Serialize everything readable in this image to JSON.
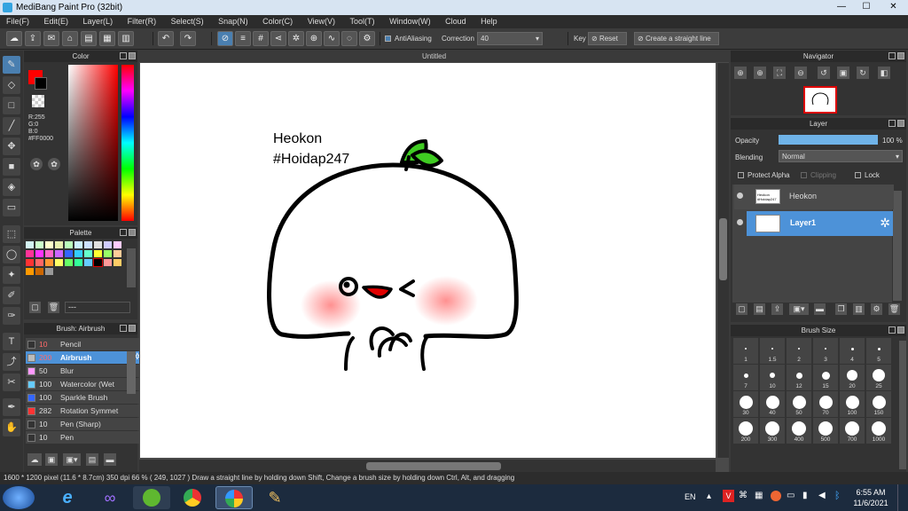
{
  "window": {
    "title": "MediBang Paint Pro (32bit)"
  },
  "menu": [
    "File(F)",
    "Edit(E)",
    "Layer(L)",
    "Filter(R)",
    "Select(S)",
    "Snap(N)",
    "Color(C)",
    "View(V)",
    "Tool(T)",
    "Window(W)",
    "Cloud",
    "Help"
  ],
  "toolbar": {
    "antialiasing": "AntiAliasing",
    "correction_label": "Correction",
    "correction_value": "40",
    "key_label": "Key",
    "reset_label": "Reset",
    "straight_line": "Create a straight line"
  },
  "color_panel": {
    "title": "Color",
    "r": "R:255",
    "g": "G:0",
    "b": "B:0",
    "hex": "#FF0000",
    "primary_color": "#ff0000"
  },
  "palette_panel": {
    "title": "Palette",
    "name": "---"
  },
  "brush_panel": {
    "title": "Brush: Airbrush",
    "items": [
      {
        "size": "10",
        "name": "Pencil",
        "swatch": "#333333"
      },
      {
        "size": "200",
        "name": "Airbrush",
        "swatch": "#bbbbbb",
        "selected": true
      },
      {
        "size": "50",
        "name": "Blur",
        "swatch": "#ff99ff"
      },
      {
        "size": "100",
        "name": "Watercolor (Wet",
        "swatch": "#66ccff"
      },
      {
        "size": "100",
        "name": "Sparkle Brush",
        "swatch": "#3366ff"
      },
      {
        "size": "282",
        "name": "Rotation Symmet",
        "swatch": "#ff3333"
      },
      {
        "size": "10",
        "name": "Pen (Sharp)",
        "swatch": "#333333"
      },
      {
        "size": "10",
        "name": "Pen",
        "swatch": "#333333"
      }
    ]
  },
  "document": {
    "tab": "Untitled",
    "text_line1": "Heokon",
    "text_line2": "#Hoidap247"
  },
  "navigator": {
    "title": "Navigator"
  },
  "layer_panel": {
    "title": "Layer",
    "opacity_label": "Opacity",
    "opacity_value": "100 %",
    "opacity_fraction": 1.0,
    "blending_label": "Blending",
    "blending_value": "Normal",
    "protect_alpha": "Protect Alpha",
    "clipping": "Clipping",
    "lock": "Lock",
    "layers": [
      {
        "name": "Heokon",
        "selected": false
      },
      {
        "name": "Layer1",
        "selected": true
      }
    ]
  },
  "brush_size_panel": {
    "title": "Brush Size",
    "sizes": [
      "1",
      "1.5",
      "2",
      "3",
      "4",
      "5",
      "7",
      "10",
      "12",
      "15",
      "20",
      "25",
      "30",
      "40",
      "50",
      "70",
      "100",
      "150",
      "200",
      "300",
      "400",
      "500",
      "700",
      "1000"
    ]
  },
  "status": {
    "text": "1600 * 1200 pixel   (11.6 * 8.7cm)   350 dpi   66 %   ( 249, 1027 )   Draw a straight line by holding down Shift, Change a brush size by holding down Ctrl, Alt, and dragging"
  },
  "taskbar": {
    "lang": "EN",
    "time": "6:55 AM",
    "date": "11/6/2021"
  }
}
